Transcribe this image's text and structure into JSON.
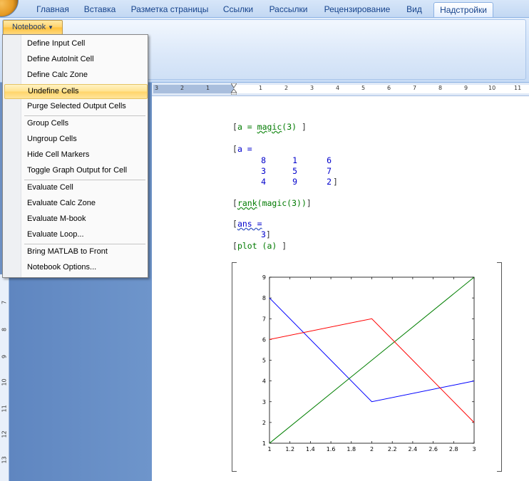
{
  "ribbon": {
    "tabs": [
      {
        "label": "Главная"
      },
      {
        "label": "Вставка"
      },
      {
        "label": "Разметка страницы"
      },
      {
        "label": "Ссылки"
      },
      {
        "label": "Рассылки"
      },
      {
        "label": "Рецензирование"
      },
      {
        "label": "Вид"
      },
      {
        "label": "Надстройки",
        "active": true
      }
    ],
    "notebook_button": "Notebook"
  },
  "menu": {
    "items": [
      {
        "label": "Define Input Cell"
      },
      {
        "label": "Define AutoInit Cell"
      },
      {
        "label": "Define Calc Zone"
      },
      {
        "label": "Undefine Cells",
        "highlighted": true
      },
      {
        "label": "Purge Selected Output Cells"
      },
      {
        "label": "Group Cells"
      },
      {
        "label": "Ungroup Cells"
      },
      {
        "label": "Hide Cell Markers"
      },
      {
        "label": "Toggle Graph Output for Cell"
      },
      {
        "label": "Evaluate Cell"
      },
      {
        "label": "Evaluate Calc Zone"
      },
      {
        "label": "Evaluate M-book"
      },
      {
        "label": "Evaluate Loop..."
      },
      {
        "label": "Bring MATLAB to Front"
      },
      {
        "label": "Notebook Options..."
      }
    ]
  },
  "ruler": {
    "horizontal": [
      "3",
      "2",
      "1",
      "1",
      "2",
      "3",
      "4",
      "5",
      "6",
      "7",
      "8",
      "9",
      "10",
      "11"
    ],
    "vertical": [
      "7",
      "8",
      "9",
      "10",
      "11",
      "12",
      "13"
    ]
  },
  "document": {
    "cell1": {
      "cmd": "a",
      "rest": " = ",
      "fn": "magic",
      "arg": "(3)"
    },
    "out1_label": "a =",
    "matrix": [
      [
        8,
        1,
        6
      ],
      [
        3,
        5,
        7
      ],
      [
        4,
        9,
        2
      ]
    ],
    "cell2": {
      "fn": "rank",
      "mid": "(magic(3))"
    },
    "ans_label": "ans =",
    "ans_value": "3",
    "cell3": "plot (a)"
  },
  "colors": {
    "series": [
      "#0000ff",
      "#007f00",
      "#ff0000"
    ],
    "input_text": "#007a00",
    "output_text": "#0000cc"
  },
  "chart_data": {
    "type": "line",
    "x": [
      1,
      2,
      3
    ],
    "series": [
      {
        "values": [
          8,
          3,
          4
        ]
      },
      {
        "values": [
          1,
          5,
          9
        ]
      },
      {
        "values": [
          6,
          7,
          2
        ]
      }
    ],
    "xlim": [
      1,
      3
    ],
    "ylim": [
      1,
      9
    ],
    "xticks": [
      "1",
      "1.2",
      "1.4",
      "1.6",
      "1.8",
      "2",
      "2.2",
      "2.4",
      "2.6",
      "2.8",
      "3"
    ],
    "yticks": [
      "1",
      "2",
      "3",
      "4",
      "5",
      "6",
      "7",
      "8",
      "9"
    ],
    "grid": false
  }
}
